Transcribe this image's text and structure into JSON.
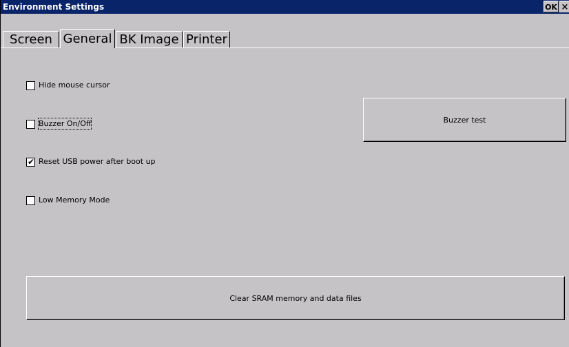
{
  "window": {
    "title": "Environment Settings",
    "ok_label": "OK",
    "close_label": "×"
  },
  "tabs": [
    {
      "label": "Screen",
      "active": false
    },
    {
      "label": "General",
      "active": true
    },
    {
      "label": "BK Image",
      "active": false
    },
    {
      "label": "Printer",
      "active": false
    }
  ],
  "options": [
    {
      "label": "Hide mouse cursor",
      "checked": false
    },
    {
      "label": "Buzzer On/Off",
      "checked": false
    },
    {
      "label": "Reset USB power after boot up",
      "checked": true
    },
    {
      "label": "Low Memory Mode",
      "checked": false
    }
  ],
  "buttons": {
    "buzzer_test": "Buzzer test",
    "clear_sram": "Clear SRAM memory and data files"
  }
}
